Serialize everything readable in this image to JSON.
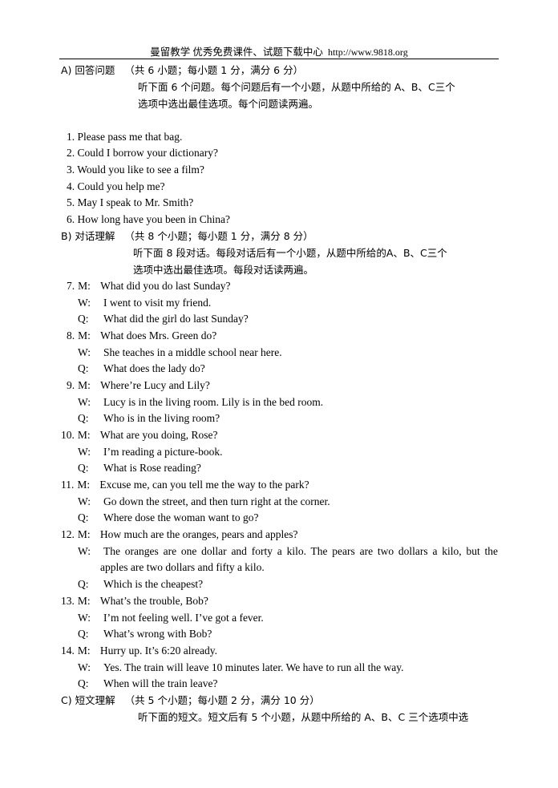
{
  "header": {
    "title": "曼留教学 优秀免费课件、试题下载中心",
    "url": "http://www.9818.org"
  },
  "sections": [
    {
      "label": "A) 回答问题",
      "scoring": "（共 6 小题；每小题 1 分，满分 6 分）",
      "instructions": [
        "听下面 6 个问题。每个问题后有一个小题，从题中所给的 A、B、C三个",
        "选项中选出最佳选项。每个问题读两遍。"
      ]
    },
    {
      "label": "B) 对话理解",
      "scoring": "（共 8 个小题；每小题 1 分，满分 8 分）",
      "instructions": [
        "听下面 8 段对话。每段对话后有一个小题，从题中所给的A、B、C三个",
        "选项中选出最佳选项。每段对话读两遍。"
      ]
    },
    {
      "label": "C) 短文理解",
      "scoring": "（共 5 个小题；每小题 2 分，满分 10 分）",
      "instructions": [
        "听下面的短文。短文后有 5 个小题，从题中所给的 A、B、C 三个选项中选"
      ]
    }
  ],
  "questions": [
    "1. Please pass me that bag.",
    "2. Could I borrow your dictionary?",
    "3. Would you like to see a film?",
    "4. Could you help me?",
    "5. May I speak to Mr. Smith?",
    "6. How long have you been in China?"
  ],
  "dialogues": [
    {
      "num": "7.",
      "m": "What did you do last Sunday?",
      "w": "I went to visit my friend.",
      "q": "What did the girl do last Sunday?"
    },
    {
      "num": "8.",
      "m": "What does Mrs. Green do?",
      "w": "She teaches in a middle school near here.",
      "q": "What does the lady do?"
    },
    {
      "num": "9.",
      "m": "Where’re Lucy and Lily?",
      "w": "Lucy is in the living room. Lily is in the bed room.",
      "q": "Who is in the living room?"
    },
    {
      "num": "10.",
      "m": "What are you doing, Rose?",
      "w": "I’m reading a picture-book.",
      "q": "What is Rose reading?"
    },
    {
      "num": "11.",
      "m": "Excuse me, can you tell me the way to the park?",
      "w": "Go down the street, and then turn right at the corner.",
      "q": "Where dose the woman want to go?"
    },
    {
      "num": "12.",
      "m": "How much are the oranges, pears and apples?",
      "w": "The oranges are one dollar and forty a kilo. The pears are two dollars a kilo, but the",
      "w2": "apples are two dollars and fifty a kilo.",
      "q": "Which is the cheapest?"
    },
    {
      "num": "13.",
      "m": "What’s the trouble, Bob?",
      "w": "I’m not feeling well. I’ve got a fever.",
      "q": "What’s wrong with Bob?"
    },
    {
      "num": "14.",
      "m": "Hurry up. It’s 6:20 already.",
      "w": "Yes. The train will leave 10 minutes later. We have to run all the way.",
      "q": "When will the train leave?"
    }
  ],
  "speakers": {
    "m": "M:",
    "w": "W:",
    "q": "Q:"
  }
}
